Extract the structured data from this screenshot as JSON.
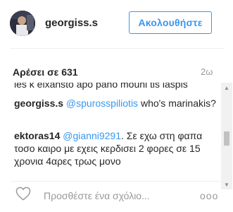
{
  "header": {
    "username": "georgiss.s",
    "follow_label": "Ακολουθήστε"
  },
  "post": {
    "likes": "Αρέσει σε 631",
    "time": "2ω"
  },
  "comments": [
    {
      "user": "",
      "mention": "",
      "text": "les k eixahsto apo pano mouni tis laspis"
    },
    {
      "user": "georgiss.s",
      "mention": "@spurosspiliotis",
      "text": " who's marinakis?"
    },
    {
      "user": "ektoras14",
      "mention": "@gianni9291",
      "text": ". Σε εχω στη φαπα τοσο καιρο με εχεις κερδισει 2 φορες σε 15 χρονια 4αρες τρως μονο"
    }
  ],
  "footer": {
    "comment_placeholder": "Προσθέστε ένα σχόλιο...",
    "more": "ooo"
  },
  "colors": {
    "accent": "#3897f0",
    "text": "#262626",
    "muted": "#999999"
  }
}
